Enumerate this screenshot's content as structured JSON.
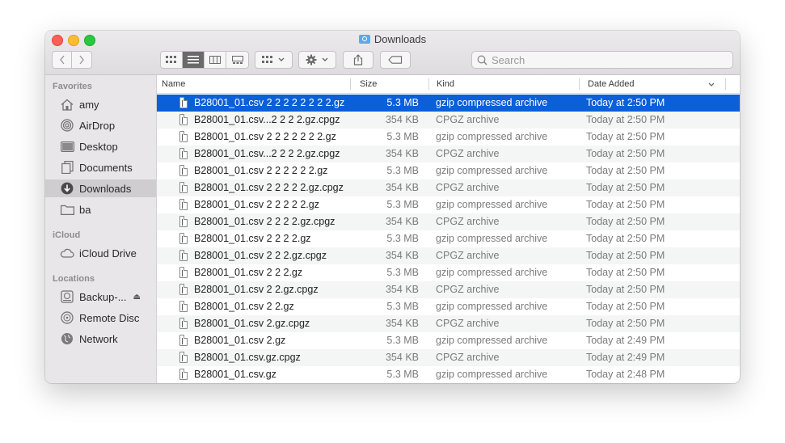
{
  "window": {
    "title": "Downloads"
  },
  "toolbar": {
    "search_placeholder": "Search"
  },
  "sidebar": {
    "sections": [
      {
        "label": "Favorites"
      },
      {
        "label": "iCloud"
      },
      {
        "label": "Locations"
      }
    ],
    "favorites": [
      {
        "label": "amy",
        "icon": "home-icon"
      },
      {
        "label": "AirDrop",
        "icon": "airdrop-icon"
      },
      {
        "label": "Desktop",
        "icon": "desktop-icon"
      },
      {
        "label": "Documents",
        "icon": "documents-icon"
      },
      {
        "label": "Downloads",
        "icon": "downloads-icon",
        "selected": true
      },
      {
        "label": "ba",
        "icon": "folder-icon"
      }
    ],
    "icloud": [
      {
        "label": "iCloud Drive",
        "icon": "cloud-icon"
      }
    ],
    "locations": [
      {
        "label": "Backup-...",
        "icon": "backup-drive-icon",
        "eject": "⏏"
      },
      {
        "label": "Remote Disc",
        "icon": "disc-icon"
      },
      {
        "label": "Network",
        "icon": "globe-icon"
      }
    ]
  },
  "columns": {
    "name": "Name",
    "size": "Size",
    "kind": "Kind",
    "date_added": "Date Added"
  },
  "files": [
    {
      "name": "B28001_01.csv 2 2 2 2 2 2 2 2.gz",
      "size": "5.3 MB",
      "kind": "gzip compressed archive",
      "date": "Today at 2:50 PM",
      "selected": true
    },
    {
      "name": "B28001_01.csv...2 2 2 2.gz.cpgz",
      "size": "354 KB",
      "kind": "CPGZ archive",
      "date": "Today at 2:50 PM"
    },
    {
      "name": "B28001_01.csv 2 2 2 2 2 2 2.gz",
      "size": "5.3 MB",
      "kind": "gzip compressed archive",
      "date": "Today at 2:50 PM"
    },
    {
      "name": "B28001_01.csv...2 2 2 2.gz.cpgz",
      "size": "354 KB",
      "kind": "CPGZ archive",
      "date": "Today at 2:50 PM"
    },
    {
      "name": "B28001_01.csv 2 2 2 2 2 2.gz",
      "size": "5.3 MB",
      "kind": "gzip compressed archive",
      "date": "Today at 2:50 PM"
    },
    {
      "name": "B28001_01.csv 2 2 2 2 2.gz.cpgz",
      "size": "354 KB",
      "kind": "CPGZ archive",
      "date": "Today at 2:50 PM"
    },
    {
      "name": "B28001_01.csv 2 2 2 2 2.gz",
      "size": "5.3 MB",
      "kind": "gzip compressed archive",
      "date": "Today at 2:50 PM"
    },
    {
      "name": "B28001_01.csv 2 2 2 2.gz.cpgz",
      "size": "354 KB",
      "kind": "CPGZ archive",
      "date": "Today at 2:50 PM"
    },
    {
      "name": "B28001_01.csv 2 2 2 2.gz",
      "size": "5.3 MB",
      "kind": "gzip compressed archive",
      "date": "Today at 2:50 PM"
    },
    {
      "name": "B28001_01.csv 2 2 2.gz.cpgz",
      "size": "354 KB",
      "kind": "CPGZ archive",
      "date": "Today at 2:50 PM"
    },
    {
      "name": "B28001_01.csv 2 2 2.gz",
      "size": "5.3 MB",
      "kind": "gzip compressed archive",
      "date": "Today at 2:50 PM"
    },
    {
      "name": "B28001_01.csv 2 2.gz.cpgz",
      "size": "354 KB",
      "kind": "CPGZ archive",
      "date": "Today at 2:50 PM"
    },
    {
      "name": "B28001_01.csv 2 2.gz",
      "size": "5.3 MB",
      "kind": "gzip compressed archive",
      "date": "Today at 2:50 PM"
    },
    {
      "name": "B28001_01.csv 2.gz.cpgz",
      "size": "354 KB",
      "kind": "CPGZ archive",
      "date": "Today at 2:50 PM"
    },
    {
      "name": "B28001_01.csv 2.gz",
      "size": "5.3 MB",
      "kind": "gzip compressed archive",
      "date": "Today at 2:49 PM"
    },
    {
      "name": "B28001_01.csv.gz.cpgz",
      "size": "354 KB",
      "kind": "CPGZ archive",
      "date": "Today at 2:49 PM"
    },
    {
      "name": "B28001_01.csv.gz",
      "size": "5.3 MB",
      "kind": "gzip compressed archive",
      "date": "Today at 2:48 PM"
    }
  ]
}
